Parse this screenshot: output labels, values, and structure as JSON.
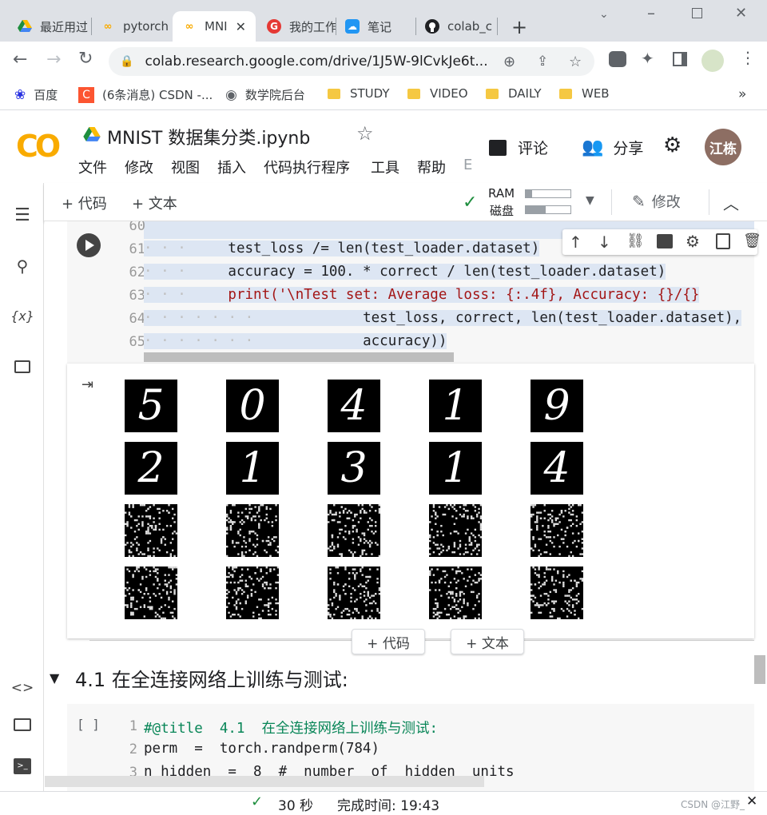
{
  "browser": {
    "tabs": [
      {
        "title": "最近用过",
        "icon": "google-drive-icon"
      },
      {
        "title": "pytorch",
        "icon": "colab-icon"
      },
      {
        "title": "MNI",
        "icon": "colab-icon",
        "active": true
      },
      {
        "title": "我的工作",
        "icon": "red-g-icon"
      },
      {
        "title": "笔记",
        "icon": "cloud-note-icon"
      },
      {
        "title": "colab_c",
        "icon": "github-icon"
      }
    ],
    "url": "colab.research.google.com/drive/1J5W-9lCvkJe6t...",
    "bookmarks": [
      {
        "label": "百度"
      },
      {
        "label": "(6条消息) CSDN -..."
      },
      {
        "label": "数学院后台"
      },
      {
        "label": "STUDY"
      },
      {
        "label": "VIDEO"
      },
      {
        "label": "DAILY"
      },
      {
        "label": "WEB"
      }
    ],
    "more_bookmarks": "»"
  },
  "colab": {
    "logo": "CO",
    "notebook_title": "MNIST 数据集分类.ipynb",
    "menus": [
      "文件",
      "修改",
      "视图",
      "插入",
      "代码执行程序",
      "工具",
      "帮助",
      "E"
    ],
    "comment_label": "评论",
    "share_label": "分享",
    "avatar_text": "江栋",
    "add_code_label": "+ 代码",
    "add_text_label": "+ 文本",
    "ram_label": "RAM",
    "disk_label": "磁盘",
    "ram_usage": 0.15,
    "disk_usage": 0.45,
    "edit_label": "修改"
  },
  "code_cell": {
    "lines": [
      {
        "num": "60",
        "text": ""
      },
      {
        "num": "61",
        "text": "    test_loss /= len(test_loader.dataset)"
      },
      {
        "num": "62",
        "text": "    accuracy = 100. * correct / len(test_loader.dataset)"
      },
      {
        "num": "63",
        "text": "    print('\\nTest set: Average loss: {:.4f}, Accuracy: {}/{}"
      },
      {
        "num": "64",
        "text": "            test_loss, correct, len(test_loader.dataset),"
      },
      {
        "num": "65",
        "text": "            accuracy))"
      }
    ]
  },
  "output_digits": [
    "5",
    "0",
    "4",
    "1",
    "9",
    "2",
    "1",
    "3",
    "1",
    "4"
  ],
  "insert_code_label": "+ 代码",
  "insert_text_label": "+ 文本",
  "section_title": "4.1 在全连接网络上训练与测试:",
  "next_cell": {
    "run_placeholder": "[ ]",
    "lines": [
      {
        "num": "1",
        "text": "#@title  4.1  在全连接网络上训练与测试:"
      },
      {
        "num": "2",
        "text": "perm  =  torch.randperm(784)"
      },
      {
        "num": "3",
        "text": "n_hidden  =  8  #  number  of  hidden  units"
      }
    ]
  },
  "status": {
    "check": "✓",
    "duration": "30 秒",
    "completion": "完成时间: 19:43",
    "watermark": "CSDN @江野_"
  }
}
